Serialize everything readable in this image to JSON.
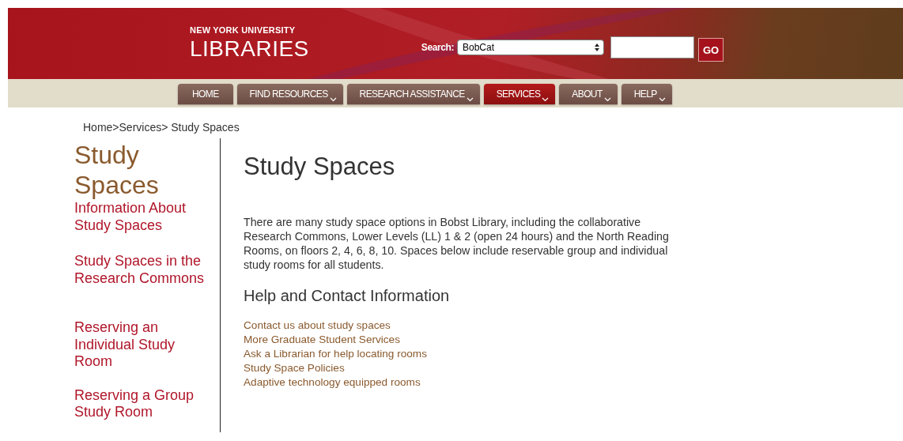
{
  "header": {
    "logo_top": "NEW YORK UNIVERSITY",
    "logo_main": "LIBRARIES",
    "search_label": "Search:",
    "search_scope": "BobCat",
    "go_button": "GO"
  },
  "nav": [
    {
      "label": "HOME",
      "has_menu": false,
      "selected": false
    },
    {
      "label": "FIND RESOURCES",
      "has_menu": true,
      "selected": false
    },
    {
      "label": "RESEARCH ASSISTANCE",
      "has_menu": true,
      "selected": false
    },
    {
      "label": "SERVICES",
      "has_menu": true,
      "selected": true
    },
    {
      "label": "ABOUT",
      "has_menu": true,
      "selected": false
    },
    {
      "label": "HELP",
      "has_menu": true,
      "selected": false
    }
  ],
  "breadcrumb": "Home>Services> Study Spaces",
  "sidebar": {
    "title": "Study Spaces",
    "items": [
      "Information About Study Spaces",
      "Study Spaces in the Research Commons",
      "Reserving an Individual Study Room",
      "Reserving a Group Study Room"
    ]
  },
  "main": {
    "title": "Study Spaces",
    "intro": "There are many study space options in Bobst Library, including the collaborative Research Commons, Lower Levels (LL) 1 & 2 (open 24 hours) and the North Reading Rooms, on floors 2, 4, 6, 8, 10. Spaces below include reservable group and individual study rooms for all students.",
    "help_title": "Help and Contact Information",
    "links": [
      "Contact us about study spaces",
      "More Graduate Student Services",
      "Ask a Librarian for help locating rooms",
      "Study Space Policies",
      "Adaptive technology equipped rooms"
    ]
  }
}
